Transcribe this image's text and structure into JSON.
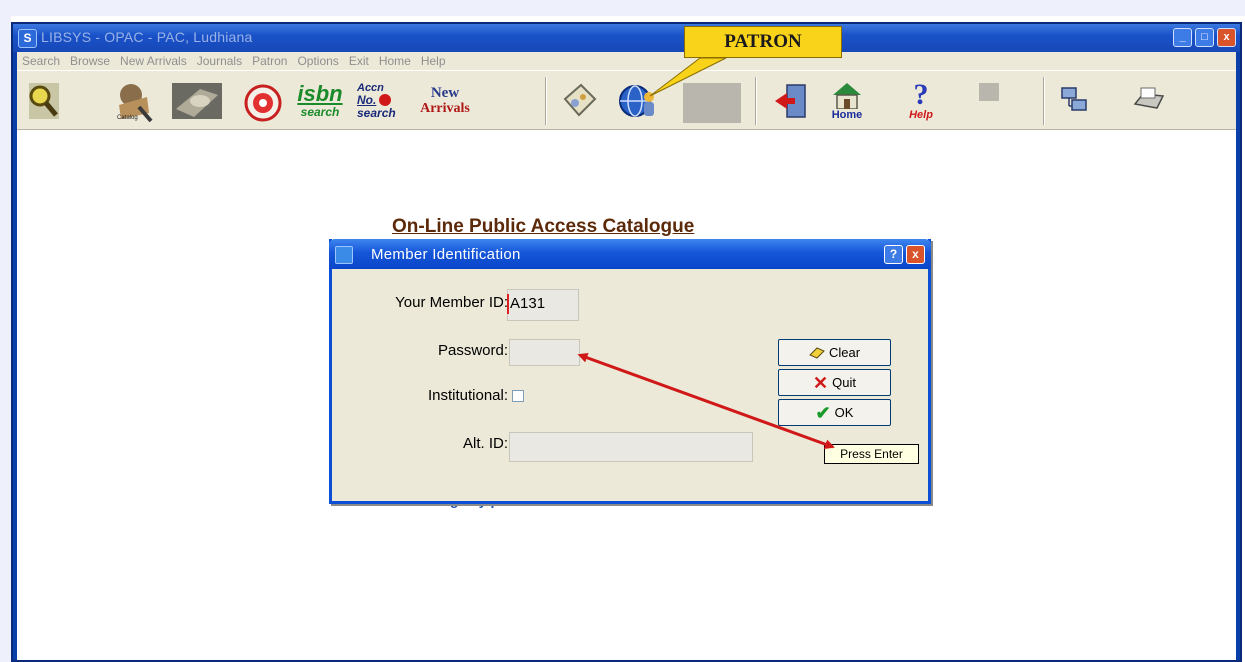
{
  "window": {
    "title": "LIBSYS - OPAC - PAC, Ludhiana",
    "buttons": {
      "minimize": "_",
      "maximize": "□",
      "close": "x"
    }
  },
  "menu": [
    "Search",
    "Browse",
    "New Arrivals",
    "Journals",
    "Patron",
    "Options",
    "Exit",
    "Home",
    "Help"
  ],
  "toolbar": {
    "isbn_top": "isbn",
    "isbn_bottom": "search",
    "accn_top": "Accn",
    "accn_mid": "No.",
    "accn_bottom": "search",
    "new_top": "New",
    "new_bottom": "Arrivals",
    "home_label": "Home",
    "help_label": "Help",
    "catalog_label": "Catalog"
  },
  "page": {
    "heading": "On-Line Public Access Catalogue",
    "partial_text": "during any procedure."
  },
  "dialog": {
    "title": "Member Identification",
    "help_btn": "?",
    "close_btn": "x",
    "member_id_label": "Your Member ID:",
    "member_id_value": "A131",
    "password_label": "Password:",
    "password_value": "",
    "institutional_label": "Institutional:",
    "alt_id_label": "Alt. ID:",
    "alt_id_value": "",
    "clear_label": "Clear",
    "quit_label": "Quit",
    "ok_label": "OK",
    "tooltip": "Press Enter"
  },
  "callout": {
    "label": "PATRON"
  },
  "colors": {
    "titlebar": "#1a52c8",
    "callout": "#f8d31a",
    "arrow": "#d01818",
    "heading": "#5c2a0a"
  }
}
